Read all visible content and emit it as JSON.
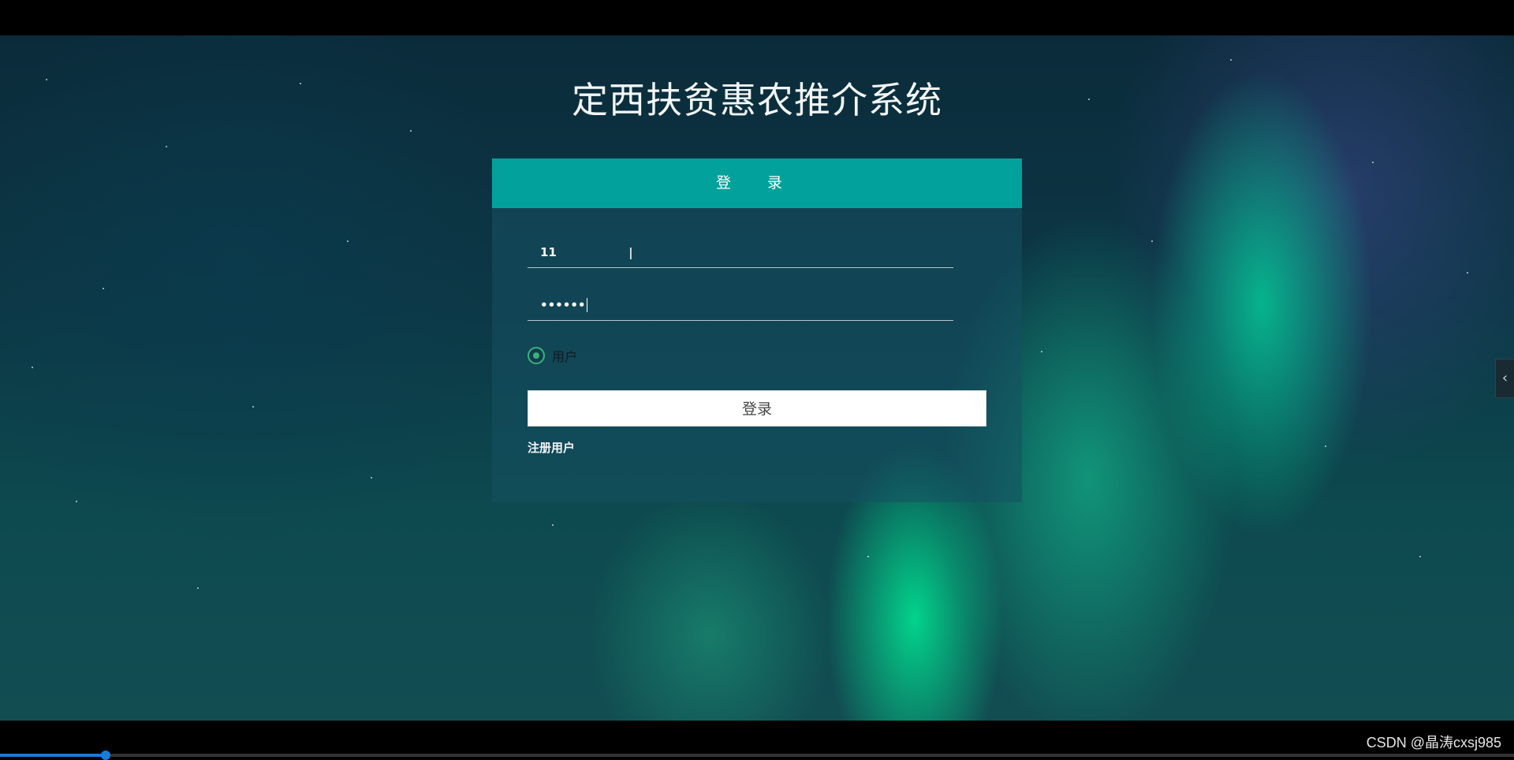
{
  "page": {
    "title": "定西扶贫惠农推介系统"
  },
  "login_panel": {
    "header": "登 录",
    "username_value": "11",
    "password_value": "••••••",
    "role_option": "用户",
    "role_selected": true,
    "submit_label": "登录",
    "register_link": "注册用户"
  },
  "side_tab": {
    "icon": "chevron-left-icon",
    "glyph": "‹"
  },
  "video": {
    "progress": 0.07
  },
  "watermark": "CSDN @晶涛cxsj985",
  "colors": {
    "header": "#03a19c",
    "radio_accent": "#3fb07c",
    "progress": "#1a7bd8"
  }
}
